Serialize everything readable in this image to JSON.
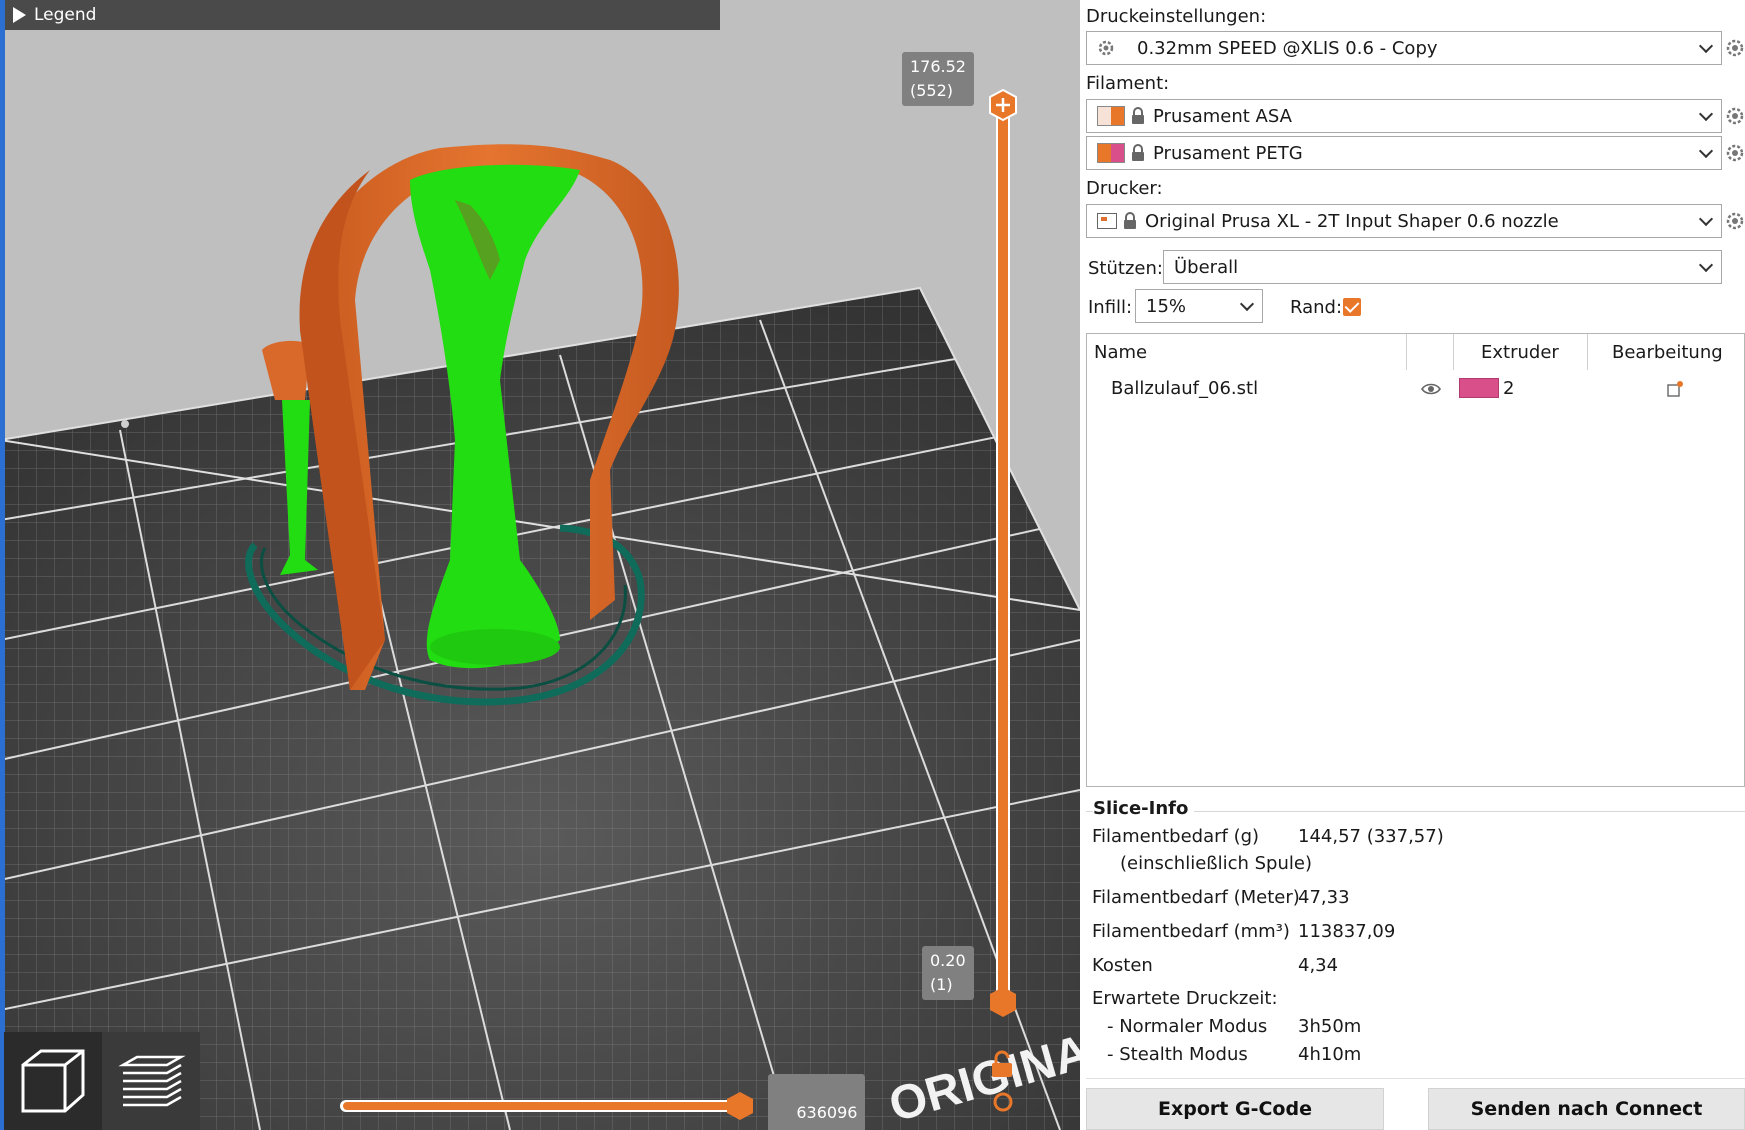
{
  "viewport": {
    "legend_label": "Legend",
    "top_slider": {
      "height": "176.52",
      "layer": "(552)"
    },
    "bottom_slider": {
      "height": "0.20",
      "layer": "(1)"
    },
    "horizontal_slider": {
      "value": "636096"
    },
    "bed_logo_text": "ORIGINAL"
  },
  "sidebar": {
    "print_settings_label": "Druckeinstellungen:",
    "print_profile": "0.32mm SPEED @XLIS 0.6 - Copy",
    "filament_label": "Filament:",
    "filaments": [
      {
        "name": "Prusament ASA",
        "color_left": "#f7e2d8",
        "color_right": "#e9772a"
      },
      {
        "name": "Prusament PETG",
        "color_left": "#e9772a",
        "color_right": "#d94f8a"
      }
    ],
    "printer_label": "Drucker:",
    "printer": "Original Prusa XL - 2T Input Shaper 0.6 nozzle",
    "supports_label": "Stützen:",
    "supports_value": "Überall",
    "infill_label": "Infill:",
    "infill_value": "15%",
    "brim_label": "Rand:",
    "object_list": {
      "columns": {
        "name": "Name",
        "extruder": "Extruder",
        "edit": "Bearbeitung"
      },
      "rows": [
        {
          "name": "Ballzulauf_06.stl",
          "extruder": "2",
          "extruder_color": "#d94f8a"
        }
      ]
    },
    "slice_info": {
      "title": "Slice-Info",
      "filament_g_label": "Filamentbedarf (g)",
      "filament_g_sub": "(einschließlich Spule)",
      "filament_g_value": "144,57 (337,57)",
      "filament_m_label": "Filamentbedarf (Meter)",
      "filament_m_value": "47,33",
      "filament_mm3_label": "Filamentbedarf (mm³)",
      "filament_mm3_value": "113837,09",
      "cost_label": "Kosten",
      "cost_value": "4,34",
      "time_label": "Erwartete Druckzeit:",
      "normal_mode_label": "- Normaler Modus",
      "normal_mode_value": "3h50m",
      "stealth_mode_label": "- Stealth Modus",
      "stealth_mode_value": "4h10m"
    },
    "export_button": "Export G-Code",
    "send_button": "Senden nach Connect"
  },
  "colors": {
    "accent": "#e9772a",
    "model_orange": "#d9692a",
    "support_green": "#22dd11",
    "skirt_teal": "#0f6b5a"
  }
}
